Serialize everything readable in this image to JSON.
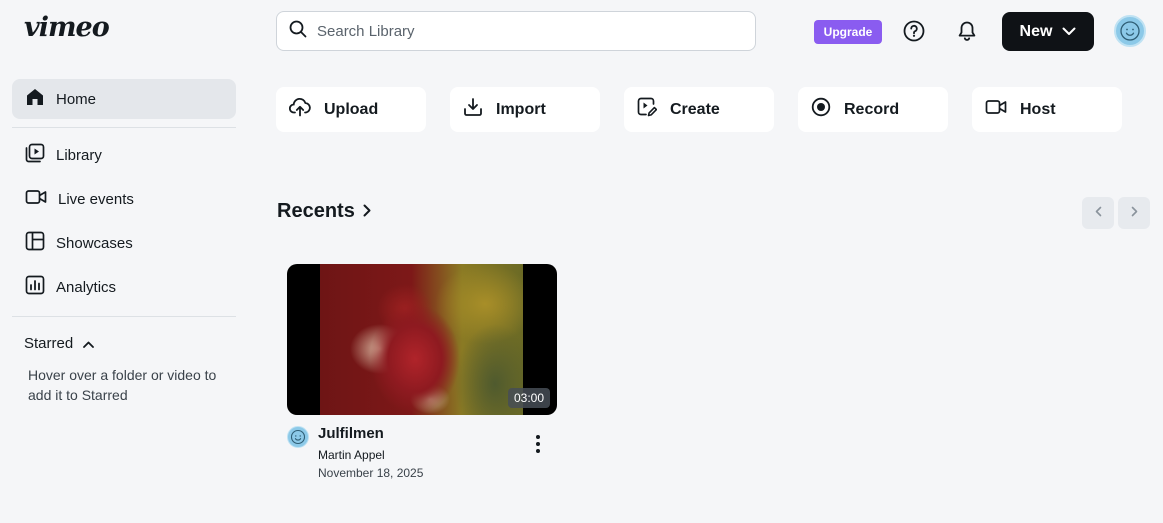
{
  "brand": {
    "logo_text": "vimeo"
  },
  "header": {
    "search_placeholder": "Search Library",
    "upgrade_label": "Upgrade",
    "new_label": "New",
    "icons": [
      "search-icon",
      "help-icon",
      "bell-icon",
      "chevron-down-icon",
      "avatar"
    ]
  },
  "sidebar": {
    "items": [
      {
        "label": "Home",
        "icon": "home-icon",
        "active": true
      },
      {
        "label": "Library",
        "icon": "library-icon",
        "active": false
      },
      {
        "label": "Live events",
        "icon": "video-camera-icon",
        "active": false
      },
      {
        "label": "Showcases",
        "icon": "showcase-icon",
        "active": false
      },
      {
        "label": "Analytics",
        "icon": "analytics-icon",
        "active": false
      }
    ],
    "starred": {
      "label": "Starred",
      "hint": "Hover over a folder or video to add it to Starred"
    }
  },
  "quick_actions": [
    {
      "label": "Upload",
      "icon": "upload-icon"
    },
    {
      "label": "Import",
      "icon": "import-icon"
    },
    {
      "label": "Create",
      "icon": "create-icon"
    },
    {
      "label": "Record",
      "icon": "record-icon"
    },
    {
      "label": "Host",
      "icon": "host-icon"
    }
  ],
  "recents": {
    "title": "Recents",
    "videos": [
      {
        "title": "Julfilmen",
        "owner": "Martin Appel",
        "date": "November 18, 2025",
        "duration": "03:00"
      }
    ]
  },
  "colors": {
    "background": "#f5f6f8",
    "upgrade": "#8a5cf0",
    "new_button": "#0f1216",
    "avatar": "#8cc9e8"
  }
}
